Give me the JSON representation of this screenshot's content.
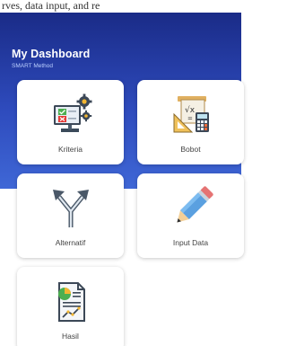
{
  "top_strip": {
    "text": "rves, data input, and re"
  },
  "header": {
    "title": "My Dashboard",
    "subtitle": "SMART Method",
    "gradient_top": "#1a2b87",
    "gradient_bottom": "#3f67d6"
  },
  "menu": [
    {
      "label": "Kriteria",
      "icon": "criteria-settings-icon"
    },
    {
      "label": "Bobot",
      "icon": "weight-ruler-calculator-icon"
    },
    {
      "label": "Alternatif",
      "icon": "alternative-arrows-icon"
    },
    {
      "label": "Input Data",
      "icon": "pencil-icon"
    },
    {
      "label": "Hasil",
      "icon": "report-chart-icon"
    }
  ]
}
